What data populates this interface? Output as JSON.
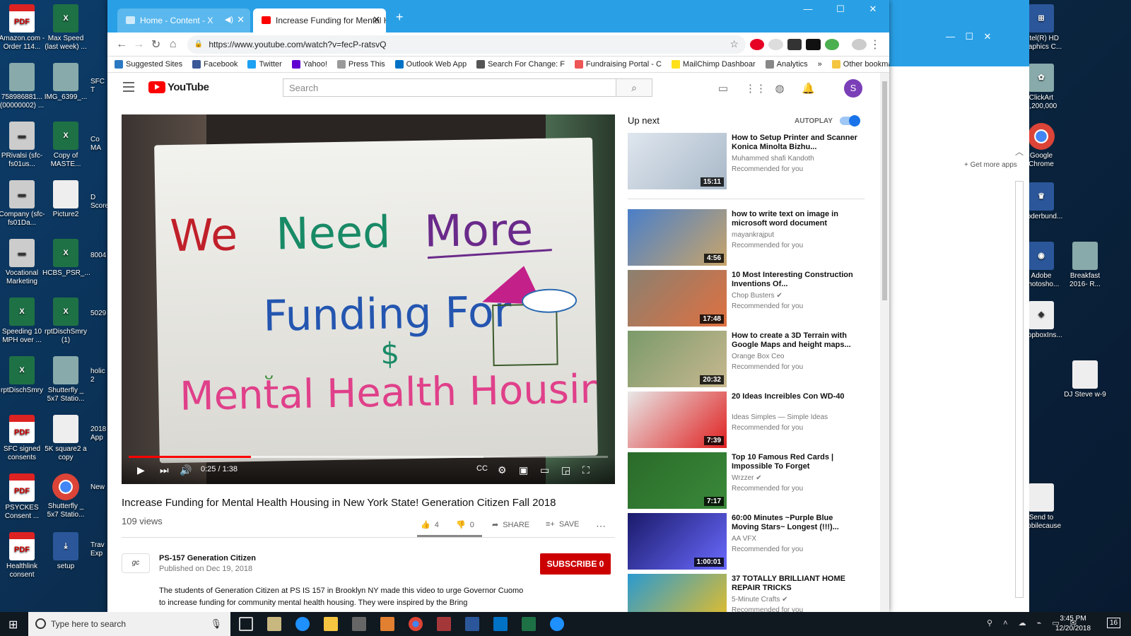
{
  "desktop": {
    "left_icons": [
      {
        "label": "Amazon.com - Order 114...",
        "kind": "pdf",
        "glyph": "PDF"
      },
      {
        "label": "Max Speed (last week) ...",
        "kind": "xls",
        "glyph": "X"
      },
      {
        "label": "758986881... (00000002) ...",
        "kind": "img",
        "glyph": ""
      },
      {
        "label": "IMG_6399_...",
        "kind": "img",
        "glyph": ""
      },
      {
        "label": "PRivalsi (sfc-fs01us...",
        "kind": "srv",
        "glyph": "▬"
      },
      {
        "label": "Copy of MASTE...",
        "kind": "xls",
        "glyph": "X"
      },
      {
        "label": "Company (sfc-fs01Da...",
        "kind": "srv",
        "glyph": "▬"
      },
      {
        "label": "Picture2",
        "kind": "file",
        "glyph": ""
      },
      {
        "label": "Vocational Marketing",
        "kind": "srv",
        "glyph": "▬"
      },
      {
        "label": "HCBS_PSR_...",
        "kind": "xls",
        "glyph": "X"
      },
      {
        "label": "Speeding 10 MPH over ...",
        "kind": "xls",
        "glyph": "X"
      },
      {
        "label": "rptDischSmry (1)",
        "kind": "xls",
        "glyph": "X"
      },
      {
        "label": "rptDischSmry",
        "kind": "xls",
        "glyph": "X"
      },
      {
        "label": "Shutterfly _ 5x7 Statio...",
        "kind": "img",
        "glyph": ""
      },
      {
        "label": "SFC signed consents",
        "kind": "pdf",
        "glyph": "PDF"
      },
      {
        "label": "5K square2 a copy",
        "kind": "file",
        "glyph": ""
      },
      {
        "label": "PSYCKES Consent ...",
        "kind": "pdf",
        "glyph": "PDF"
      },
      {
        "label": "Shutterfly _ 5x7 Statio...",
        "kind": "chrome",
        "glyph": ""
      },
      {
        "label": "Healthlink consent",
        "kind": "pdf",
        "glyph": "PDF"
      },
      {
        "label": "setup",
        "kind": "doc",
        "glyph": "⤓"
      }
    ],
    "partial_labels": [
      "SFC T",
      "Co MA",
      "D Score",
      "8004",
      "5029",
      "holic 2",
      "2018 App",
      "New",
      "Trav Exp"
    ],
    "right_icons": [
      {
        "label": "Intel(R) HD Graphics C...",
        "kind": "doc",
        "glyph": "⊞"
      },
      {
        "label": "ClickArt 1,200,000",
        "kind": "img",
        "glyph": "✿"
      },
      {
        "label": "Google Chrome",
        "kind": "chrome",
        "glyph": ""
      },
      {
        "label": "Broderbund...",
        "kind": "doc",
        "glyph": "♛"
      },
      {
        "label": "Adobe Photosho...",
        "kind": "doc",
        "glyph": "◉"
      },
      {
        "label": "Breakfast 2016- R...",
        "kind": "img",
        "glyph": ""
      },
      {
        "label": "DropboxIns...",
        "kind": "file",
        "glyph": "❖"
      },
      {
        "label": "DJ Steve w-9",
        "kind": "file",
        "glyph": ""
      },
      {
        "label": "Send to Mobilecause",
        "kind": "file",
        "glyph": ""
      }
    ]
  },
  "browser": {
    "tabs": [
      {
        "title": "Home - Content - X",
        "active": false
      },
      {
        "title": "Increase Funding for Mental Hea",
        "active": true
      }
    ],
    "new_tab_glyph": "+",
    "url": "https://www.youtube.com/watch?v=fecP-ratsvQ",
    "bookmarks": [
      {
        "label": "Suggested Sites",
        "color": "#2b78c2"
      },
      {
        "label": "Facebook",
        "color": "#3b5998"
      },
      {
        "label": "Twitter",
        "color": "#1da1f2"
      },
      {
        "label": "Yahoo!",
        "color": "#5f01d1"
      },
      {
        "label": "Press This",
        "color": "#999"
      },
      {
        "label": "Outlook Web App",
        "color": "#0072c6"
      },
      {
        "label": "Search For Change: F",
        "color": "#555"
      },
      {
        "label": "Fundraising Portal - C",
        "color": "#e55"
      },
      {
        "label": "MailChimp Dashboar",
        "color": "#ffe01b"
      },
      {
        "label": "Analytics",
        "color": "#888"
      },
      {
        "label": "»",
        "color": ""
      },
      {
        "label": "Other bookmarks",
        "color": "#f5c542"
      }
    ]
  },
  "youtube": {
    "logo": "YouTube",
    "search_placeholder": "Search",
    "avatar_letter": "S",
    "video": {
      "sign_lines": [
        "We Need More",
        "Funding For",
        "Mental Health Housing"
      ],
      "time": "0:25 / 1:38",
      "progress": 0.255,
      "buffered": 0.74
    },
    "title": "Increase Funding for Mental Health Housing in New York State! Generation Citizen Fall 2018",
    "views": "109 views",
    "likes": "4",
    "dislikes": "0",
    "share_label": "SHARE",
    "save_label": "SAVE",
    "channel_name": "PS-157 Generation Citizen",
    "channel_logo_text": "gc",
    "published": "Published on Dec 19, 2018",
    "subscribe_label": "SUBSCRIBE",
    "subscribe_count": "0",
    "description": "The students of Generation Citizen at PS IS 157 in Brooklyn NY made this video to urge Governor Cuomo to increase funding for community mental health housing. They were inspired by the Bring",
    "up_next_label": "Up next",
    "autoplay_label": "AUTOPLAY",
    "recommendations": [
      {
        "title": "How to Setup Printer and Scanner Konica Minolta Bizhu...",
        "channel": "Muhammed shafi Kandoth",
        "note": "Recommended for you",
        "duration": "15:11",
        "c1": "#dfe6ee",
        "c2": "#a8b8c8"
      },
      {
        "title": "how to write text on image in microsoft word document",
        "channel": "mayankrajput",
        "note": "Recommended for you",
        "duration": "4:56",
        "c1": "#4a7fc9",
        "c2": "#c9a56a"
      },
      {
        "title": "10 Most Interesting Construction Inventions Of...",
        "channel": "Chop Busters ✔",
        "note": "Recommended for you",
        "duration": "17:48",
        "c1": "#8a8070",
        "c2": "#e07040"
      },
      {
        "title": "How to create a 3D Terrain with Google Maps and height maps...",
        "channel": "Orange Box Ceo",
        "note": "Recommended for you",
        "duration": "20:32",
        "c1": "#7a9a6a",
        "c2": "#c8b890"
      },
      {
        "title": "20 Ideas Increibles Con WD-40",
        "channel": "Ideas Simples — Simple Ideas",
        "note": "Recommended for you",
        "duration": "7:39",
        "c1": "#e8e8e8",
        "c2": "#e02020"
      },
      {
        "title": "Top 10 Famous Red Cards | Impossible To Forget",
        "channel": "Wrzzer ✔",
        "note": "Recommended for you",
        "duration": "7:17",
        "c1": "#2a6a2a",
        "c2": "#3a8a3a"
      },
      {
        "title": "60:00 Minutes ~Purple Blue Moving Stars~ Longest (!!!)...",
        "channel": "AA VFX",
        "note": "Recommended for you",
        "duration": "1:00:01",
        "c1": "#1a1a6a",
        "c2": "#6a6aff"
      },
      {
        "title": "37 TOTALLY BRILLIANT HOME REPAIR TRICKS",
        "channel": "5-Minute Crafts ✔",
        "note": "Recommended for you",
        "duration": "",
        "c1": "#2a9ad0",
        "c2": "#f0c020"
      }
    ]
  },
  "side_panel": {
    "get_more_apps": "Get more apps"
  },
  "taskbar": {
    "search_placeholder": "Type here to search",
    "time": "3:45 PM",
    "date": "12/20/2018",
    "notif_count": "16"
  }
}
